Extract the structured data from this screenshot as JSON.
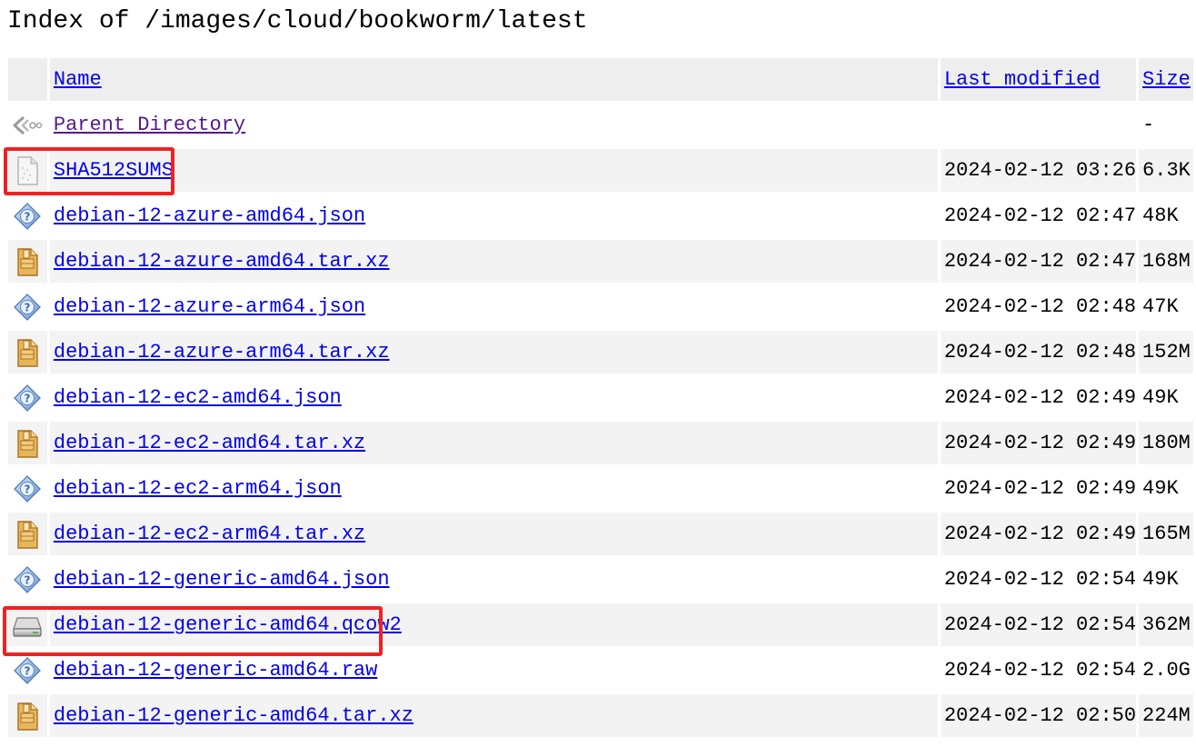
{
  "page": {
    "title": "Index of /images/cloud/bookworm/latest"
  },
  "table": {
    "headers": {
      "name": "Name",
      "last_modified": "Last modified",
      "size": "Size"
    },
    "parent": {
      "name": "Parent Directory",
      "size": "-",
      "icon": "back-arrow-icon"
    },
    "rows": [
      {
        "name": "SHA512SUMS",
        "date": "2024-02-12 03:26",
        "size": "6.3K",
        "icon": "text-file-icon"
      },
      {
        "name": "debian-12-azure-amd64.json",
        "date": "2024-02-12 02:47",
        "size": "48K",
        "icon": "unknown-file-icon"
      },
      {
        "name": "debian-12-azure-amd64.tar.xz",
        "date": "2024-02-12 02:47",
        "size": "168M",
        "icon": "compressed-file-icon"
      },
      {
        "name": "debian-12-azure-arm64.json",
        "date": "2024-02-12 02:48",
        "size": "47K",
        "icon": "unknown-file-icon"
      },
      {
        "name": "debian-12-azure-arm64.tar.xz",
        "date": "2024-02-12 02:48",
        "size": "152M",
        "icon": "compressed-file-icon"
      },
      {
        "name": "debian-12-ec2-amd64.json",
        "date": "2024-02-12 02:49",
        "size": "49K",
        "icon": "unknown-file-icon"
      },
      {
        "name": "debian-12-ec2-amd64.tar.xz",
        "date": "2024-02-12 02:49",
        "size": "180M",
        "icon": "compressed-file-icon"
      },
      {
        "name": "debian-12-ec2-arm64.json",
        "date": "2024-02-12 02:49",
        "size": "49K",
        "icon": "unknown-file-icon"
      },
      {
        "name": "debian-12-ec2-arm64.tar.xz",
        "date": "2024-02-12 02:49",
        "size": "165M",
        "icon": "compressed-file-icon"
      },
      {
        "name": "debian-12-generic-amd64.json",
        "date": "2024-02-12 02:54",
        "size": "49K",
        "icon": "unknown-file-icon"
      },
      {
        "name": "debian-12-generic-amd64.qcow2",
        "date": "2024-02-12 02:54",
        "size": "362M",
        "icon": "disk-image-icon"
      },
      {
        "name": "debian-12-generic-amd64.raw",
        "date": "2024-02-12 02:54",
        "size": "2.0G",
        "icon": "unknown-file-icon"
      },
      {
        "name": "debian-12-generic-amd64.tar.xz",
        "date": "2024-02-12 02:50",
        "size": "224M",
        "icon": "compressed-file-icon"
      }
    ]
  },
  "colors": {
    "link": "#0000ee",
    "visited_link": "#551a8b",
    "header_bg": "#eeeeee",
    "alt_row_bg": "#f3f3f3",
    "highlight": "#ee2222"
  }
}
